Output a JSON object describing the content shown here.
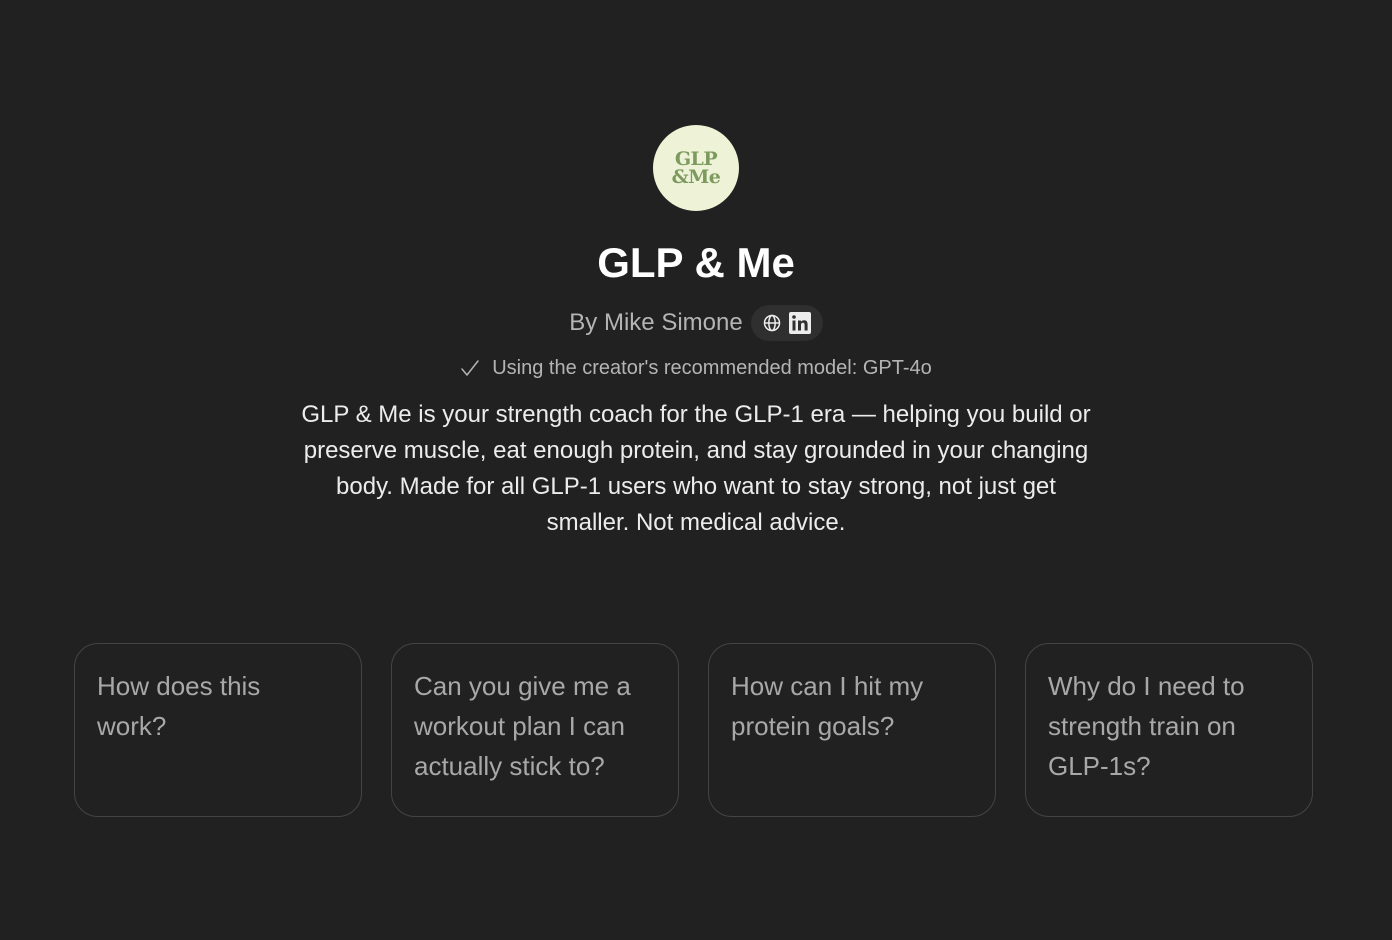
{
  "gpt": {
    "logo_line1": "GLP",
    "logo_line2": "&Me",
    "name": "GLP & Me",
    "author": "By Mike Simone",
    "model_note": "Using the creator's recommended model: GPT-4o",
    "description": "GLP & Me is your strength coach for the GLP-1 era — helping you build or preserve muscle, eat enough protein, and stay grounded in your changing body. Made for all GLP-1 users who want to stay strong, not just get smaller. Not medical advice."
  },
  "icons": {
    "website": "globe-icon",
    "linkedin": "linkedin-icon",
    "check": "check-icon"
  },
  "colors": {
    "background": "#212121",
    "logo_bg": "#eef3d8",
    "logo_text": "#7d9a5e",
    "title": "#ffffff",
    "muted": "#b4b4b4",
    "card_border": "#444444"
  },
  "starters": [
    {
      "label": "How does this work?"
    },
    {
      "label": "Can you give me a workout plan I can actually stick to?"
    },
    {
      "label": "How can I hit my protein goals?"
    },
    {
      "label": "Why do I need to strength train on GLP-1s?"
    }
  ]
}
